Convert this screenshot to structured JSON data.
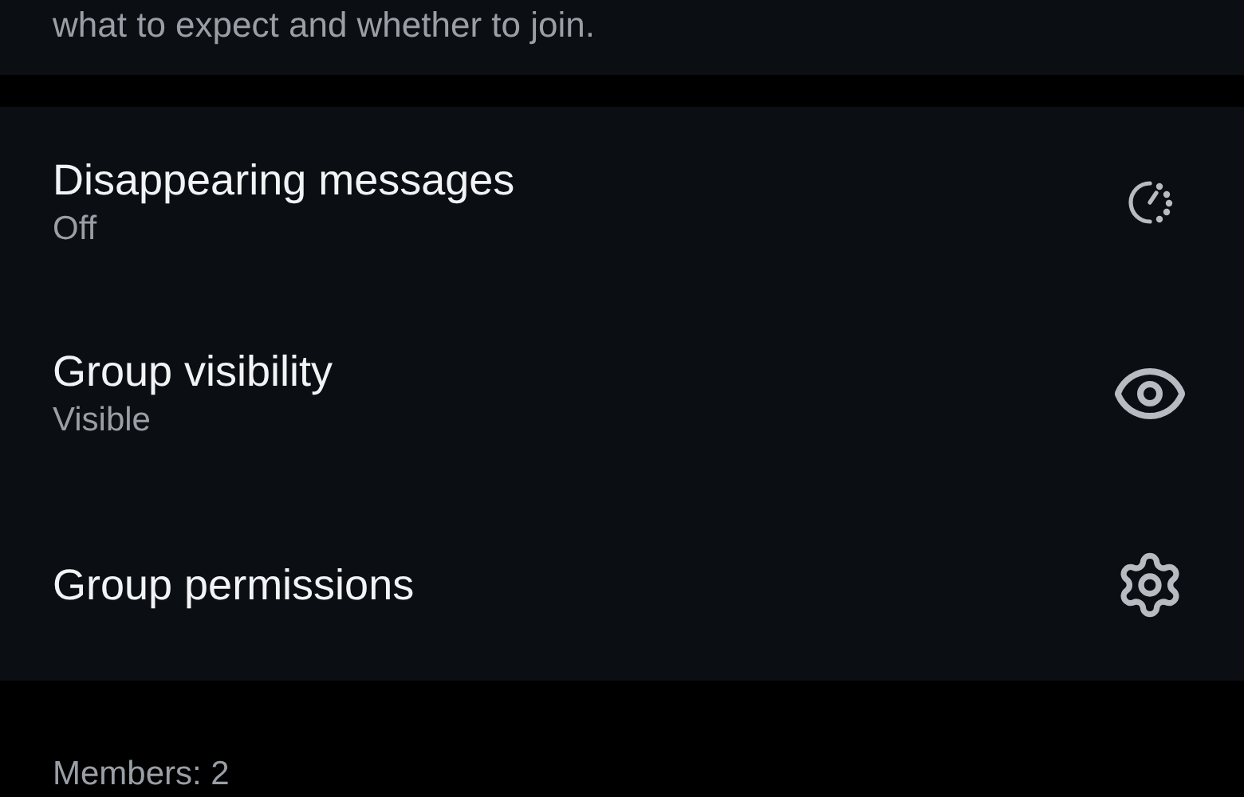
{
  "description": {
    "text": "what to expect and whether to join."
  },
  "settings": [
    {
      "kind": "timer",
      "title": "Disappearing messages",
      "value": "Off"
    },
    {
      "kind": "eye",
      "title": "Group visibility",
      "value": "Visible"
    },
    {
      "kind": "gear",
      "title": "Group permissions"
    }
  ],
  "members": {
    "label": "Members: 2"
  }
}
